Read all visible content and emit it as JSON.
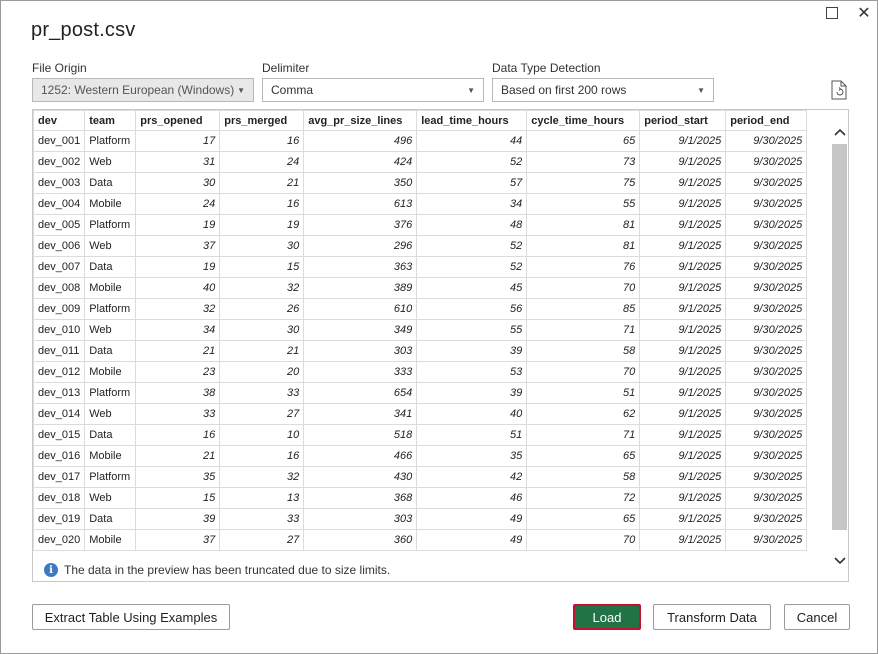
{
  "window": {
    "title": "pr_post.csv"
  },
  "options": {
    "file_origin_label": "File Origin",
    "file_origin_value": "1252: Western European (Windows)",
    "delimiter_label": "Delimiter",
    "delimiter_value": "Comma",
    "detection_label": "Data Type Detection",
    "detection_value": "Based on first 200 rows"
  },
  "table": {
    "columns": [
      "dev",
      "team",
      "prs_opened",
      "prs_merged",
      "avg_pr_size_lines",
      "lead_time_hours",
      "cycle_time_hours",
      "period_start",
      "period_end"
    ],
    "rows": [
      [
        "dev_001",
        "Platform",
        "17",
        "16",
        "496",
        "44",
        "65",
        "9/1/2025",
        "9/30/2025"
      ],
      [
        "dev_002",
        "Web",
        "31",
        "24",
        "424",
        "52",
        "73",
        "9/1/2025",
        "9/30/2025"
      ],
      [
        "dev_003",
        "Data",
        "30",
        "21",
        "350",
        "57",
        "75",
        "9/1/2025",
        "9/30/2025"
      ],
      [
        "dev_004",
        "Mobile",
        "24",
        "16",
        "613",
        "34",
        "55",
        "9/1/2025",
        "9/30/2025"
      ],
      [
        "dev_005",
        "Platform",
        "19",
        "19",
        "376",
        "48",
        "81",
        "9/1/2025",
        "9/30/2025"
      ],
      [
        "dev_006",
        "Web",
        "37",
        "30",
        "296",
        "52",
        "81",
        "9/1/2025",
        "9/30/2025"
      ],
      [
        "dev_007",
        "Data",
        "19",
        "15",
        "363",
        "52",
        "76",
        "9/1/2025",
        "9/30/2025"
      ],
      [
        "dev_008",
        "Mobile",
        "40",
        "32",
        "389",
        "45",
        "70",
        "9/1/2025",
        "9/30/2025"
      ],
      [
        "dev_009",
        "Platform",
        "32",
        "26",
        "610",
        "56",
        "85",
        "9/1/2025",
        "9/30/2025"
      ],
      [
        "dev_010",
        "Web",
        "34",
        "30",
        "349",
        "55",
        "71",
        "9/1/2025",
        "9/30/2025"
      ],
      [
        "dev_011",
        "Data",
        "21",
        "21",
        "303",
        "39",
        "58",
        "9/1/2025",
        "9/30/2025"
      ],
      [
        "dev_012",
        "Mobile",
        "23",
        "20",
        "333",
        "53",
        "70",
        "9/1/2025",
        "9/30/2025"
      ],
      [
        "dev_013",
        "Platform",
        "38",
        "33",
        "654",
        "39",
        "51",
        "9/1/2025",
        "9/30/2025"
      ],
      [
        "dev_014",
        "Web",
        "33",
        "27",
        "341",
        "40",
        "62",
        "9/1/2025",
        "9/30/2025"
      ],
      [
        "dev_015",
        "Data",
        "16",
        "10",
        "518",
        "51",
        "71",
        "9/1/2025",
        "9/30/2025"
      ],
      [
        "dev_016",
        "Mobile",
        "21",
        "16",
        "466",
        "35",
        "65",
        "9/1/2025",
        "9/30/2025"
      ],
      [
        "dev_017",
        "Platform",
        "35",
        "32",
        "430",
        "42",
        "58",
        "9/1/2025",
        "9/30/2025"
      ],
      [
        "dev_018",
        "Web",
        "15",
        "13",
        "368",
        "46",
        "72",
        "9/1/2025",
        "9/30/2025"
      ],
      [
        "dev_019",
        "Data",
        "39",
        "33",
        "303",
        "49",
        "65",
        "9/1/2025",
        "9/30/2025"
      ],
      [
        "dev_020",
        "Mobile",
        "37",
        "27",
        "360",
        "49",
        "70",
        "9/1/2025",
        "9/30/2025"
      ]
    ],
    "notice": "The data in the preview has been truncated due to size limits."
  },
  "buttons": {
    "extract": "Extract Table Using Examples",
    "load": "Load",
    "transform": "Transform Data",
    "cancel": "Cancel"
  },
  "icons": {
    "maximize": "maximize-icon",
    "close": "close-icon",
    "refresh_file": "file-refresh-icon",
    "info": "info-icon",
    "dropdown": "chevron-down-icon"
  },
  "colors": {
    "load_button_bg": "#217346",
    "load_button_border": "#c8102e",
    "info_icon": "#3c7bc0"
  }
}
